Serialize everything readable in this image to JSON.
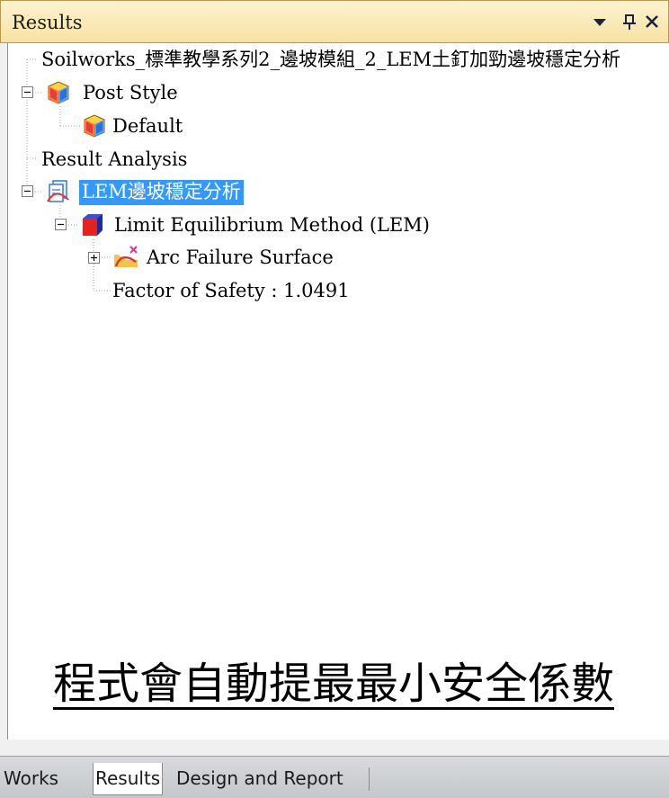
{
  "panel": {
    "title": "Results",
    "buttons": {
      "dropdown": "dropdown-arrow-icon",
      "pin": "pin-icon",
      "close": "close-icon"
    }
  },
  "tree": [
    {
      "label": "Soilworks_標準教學系列2_邊坡模組_2_LEM土釘加勁邊坡穩定分析",
      "icon": null,
      "expander": null
    },
    {
      "label": "Post Style",
      "icon": "post-style-icon",
      "expander": "collapse"
    },
    {
      "label": "Default",
      "icon": "post-style-icon",
      "expander": null
    },
    {
      "label": "Result Analysis",
      "icon": null,
      "expander": null
    },
    {
      "label": "LEM邊坡穩定分析",
      "icon": "analysis-document-icon",
      "expander": "collapse",
      "selected": true
    },
    {
      "label": "Limit Equilibrium Method (LEM)",
      "icon": "lem-cube-icon",
      "expander": "collapse"
    },
    {
      "label": "Arc Failure Surface",
      "icon": "arc-failure-icon",
      "expander": "expand"
    },
    {
      "label": "Factor of Safety : 1.0491",
      "icon": null,
      "expander": null
    }
  ],
  "annotation": "程式會自動提最最小安全係數",
  "tabs": [
    {
      "label": "Works",
      "active": false
    },
    {
      "label": "Results",
      "active": true
    },
    {
      "label": "Design and Report",
      "active": false
    }
  ],
  "colors": {
    "titlebar": "#f8e2a3",
    "selection": "#3399ff",
    "tree_background": "#ffffff"
  }
}
